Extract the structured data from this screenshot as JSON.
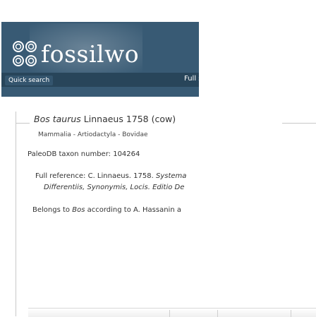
{
  "header": {
    "logo_text": "fossilwo",
    "quick_search_label": "Quick search",
    "full_search_label": "Full se"
  },
  "taxon": {
    "genus": "Bos",
    "species": "taurus",
    "authority": "Linnaeus 1758",
    "common_name": "(cow)",
    "classification": "Mammalia - Artiodactyla - Bovidae",
    "taxon_number_label": "PaleoDB taxon number:",
    "taxon_number": "104264",
    "full_reference_label": "Full reference:",
    "full_reference_line1_plain": "C. Linnaeus. 1758.",
    "full_reference_line1_italic": "Systema",
    "full_reference_line2": "Differentiis, Synonymis, Locis. Editio De",
    "belongs_prefix": "Belongs to",
    "belongs_genus": "Bos",
    "belongs_suffix": "according to A. Hassanin a"
  },
  "colors": {
    "banner": "#385a74",
    "banner_strip": "#28455a",
    "text": "#333333"
  }
}
